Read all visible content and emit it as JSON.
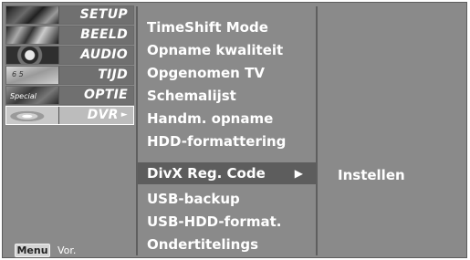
{
  "categories": [
    {
      "label": "SETUP",
      "icon": "setup-thumbnail-icon"
    },
    {
      "label": "BEELD",
      "icon": "beeld-thumbnail-icon"
    },
    {
      "label": "AUDIO",
      "icon": "audio-thumbnail-icon"
    },
    {
      "label": "TIJD",
      "icon": "tijd-thumbnail-icon"
    },
    {
      "label": "OPTIE",
      "icon": "optie-thumbnail-icon"
    },
    {
      "label": "DVR",
      "icon": "dvr-thumbnail-icon",
      "active": true
    }
  ],
  "thumb_texts": {
    "tijd_digits": "6 5",
    "optie_text": "Special"
  },
  "arrow_right": "►",
  "footer": {
    "menu_button": "Menu",
    "back_label": "Vor."
  },
  "menu_items": [
    "TimeShift Mode",
    "Opname kwaliteit",
    "Opgenomen TV",
    "Schemalijst",
    "Handm. opname",
    "HDD-formattering",
    "DivX Reg. Code",
    "USB-backup",
    "USB-HDD-format.",
    "Ondertitelings"
  ],
  "selected_index": 6,
  "selected_arrow": "▶",
  "right_panel": {
    "value": "Instellen"
  },
  "colors": {
    "background": "#8a8a8a",
    "selected_row": "#5d5d5d",
    "text": "#ffffff"
  }
}
